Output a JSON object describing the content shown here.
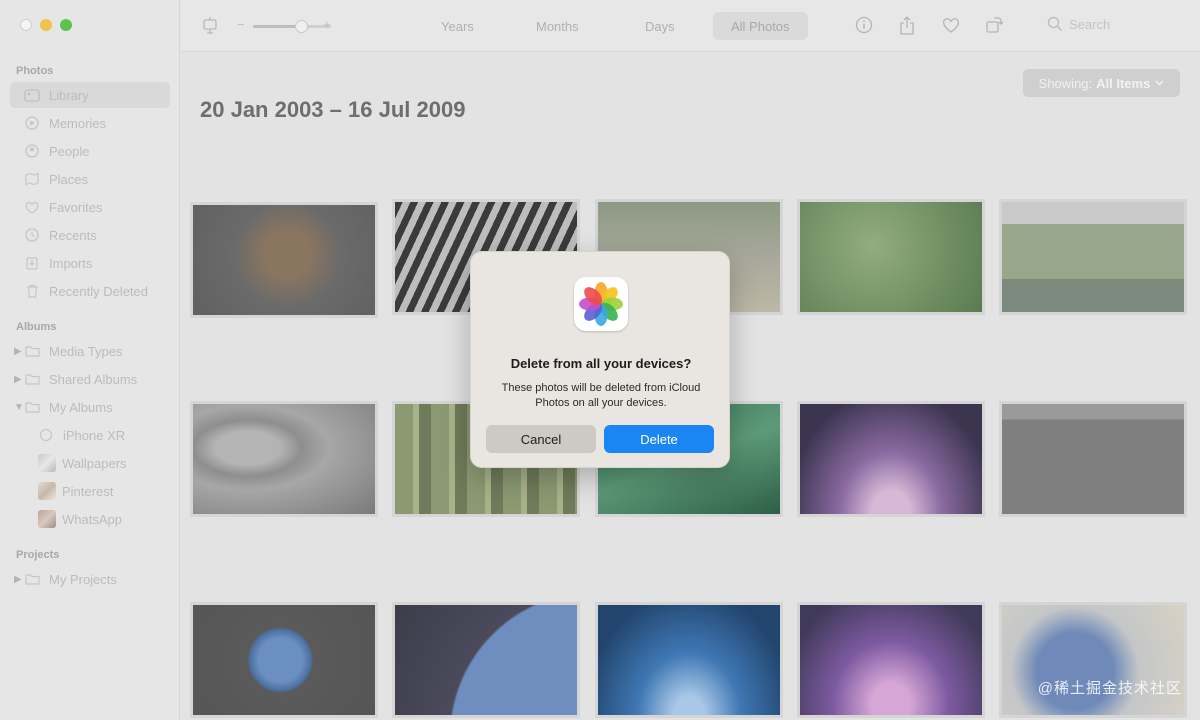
{
  "sidebar": {
    "sections": [
      {
        "title": "Photos"
      },
      {
        "title": "Albums"
      },
      {
        "title": "Projects"
      }
    ],
    "photos_items": [
      {
        "label": "Library",
        "icon": "library-icon"
      },
      {
        "label": "Memories",
        "icon": "memories-icon"
      },
      {
        "label": "People",
        "icon": "people-icon"
      },
      {
        "label": "Places",
        "icon": "places-icon"
      },
      {
        "label": "Favorites",
        "icon": "heart-icon"
      },
      {
        "label": "Recents",
        "icon": "clock-icon"
      },
      {
        "label": "Imports",
        "icon": "import-icon"
      },
      {
        "label": "Recently Deleted",
        "icon": "trash-icon"
      }
    ],
    "album_items": [
      {
        "label": "Media Types"
      },
      {
        "label": "Shared Albums"
      },
      {
        "label": "My Albums"
      },
      {
        "label": "iPhone XR"
      },
      {
        "label": "Wallpapers"
      },
      {
        "label": "Pinterest"
      },
      {
        "label": "WhatsApp"
      }
    ],
    "project_items": [
      {
        "label": "My Projects"
      }
    ]
  },
  "toolbar": {
    "zoom_minus": "−",
    "zoom_plus": "+",
    "zoom_level": 0.6,
    "tabs": [
      {
        "label": "Years"
      },
      {
        "label": "Months"
      },
      {
        "label": "Days"
      },
      {
        "label": "All Photos"
      }
    ],
    "active_tab": "All Photos",
    "search_placeholder": "Search"
  },
  "main": {
    "date_range": "20 Jan 2003 – 16 Jul 2009",
    "showing_label": "Showing:",
    "showing_value": "All Items"
  },
  "dialog": {
    "title": "Delete from all your devices?",
    "message": "These photos will be deleted from iCloud Photos on all your devices.",
    "cancel_label": "Cancel",
    "delete_label": "Delete",
    "delete_color": "#1a86f3"
  },
  "watermark": "@稀土掘金技术社区"
}
